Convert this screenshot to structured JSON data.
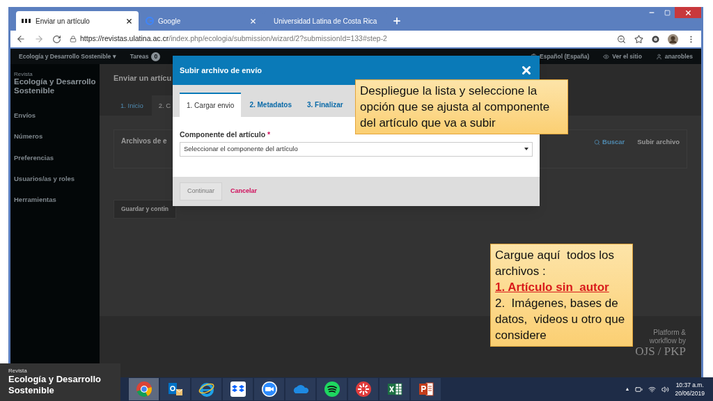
{
  "browser": {
    "tabs": [
      {
        "kind": "pkp",
        "title": "Enviar un artículo",
        "selected": true
      },
      {
        "kind": "google",
        "title": "Google",
        "selected": false
      },
      {
        "kind": "globe",
        "title": "Universidad Latina de Costa Rica",
        "selected": false
      }
    ],
    "url_host": "https://revistas.ulatina.ac.cr",
    "url_path": "/index.php/ecologia/submission/wizard/2?submissionId=133#step-2"
  },
  "site_nav": {
    "journal": "Ecología y Desarrollo Sostenible",
    "journal_caret": "▾",
    "tasks": "Tareas",
    "task_count": "0",
    "language": "Español (España)",
    "view_site": "Ver el sitio",
    "user": "anarobles"
  },
  "sidebar": {
    "kicker": "Revista",
    "journal": "Ecología y Desarrollo Sostenible",
    "items": [
      "Envíos",
      "Números",
      "Preferencias",
      "Usuarios/as y roles",
      "Herramientas"
    ]
  },
  "page": {
    "title": "Enviar un artícu",
    "tabs": [
      {
        "label": "1. Inicio",
        "selected": false
      },
      {
        "label": "2. C",
        "selected": true
      }
    ],
    "panel_title": "Archivos de e",
    "search": "Buscar",
    "upload": "Subir archivo",
    "save_button": "Guardar y contin",
    "footer": [
      "Platform &",
      "workflow by",
      "OJS / PKP"
    ]
  },
  "modal": {
    "title": "Subir archivo de envío",
    "tabs": [
      {
        "label": "1. Cargar envio",
        "selected": true
      },
      {
        "label": "2. Metadatos",
        "selected": false
      },
      {
        "label": "3. Finalizar",
        "selected": false
      }
    ],
    "field_label": "Componente del artículo",
    "required": "*",
    "select_value": "Seleccionar el componente del artículo",
    "continue": {
      "label": "Continuar",
      "disabled": true
    },
    "cancel": "Cancelar"
  },
  "callouts": [
    {
      "paragraphs": [
        {
          "kind": "text",
          "text": "Despliegue la lista y seleccione la opción que se ajusta al componente del artículo que va a subir"
        }
      ]
    },
    {
      "paragraphs": [
        {
          "kind": "text",
          "text": "Cargue aquí  todos los archivos :"
        },
        {
          "kind": "highlight",
          "text": "1. Artículo sin  autor"
        },
        {
          "kind": "text",
          "text": "2.  Imágenes, bases de datos,  videos u otro que considere"
        }
      ]
    }
  ],
  "overlay_label": {
    "kicker": "Revista",
    "title": "Ecología y Desarrollo Sostenible"
  },
  "taskbar": {
    "apps": [
      {
        "kind": "chrome",
        "selected": true
      },
      {
        "kind": "mail",
        "selected": false
      },
      {
        "kind": "ie",
        "selected": false
      },
      {
        "kind": "box",
        "selected": false
      },
      {
        "kind": "video",
        "selected": false
      },
      {
        "kind": "cloud",
        "selected": false
      },
      {
        "kind": "music",
        "selected": false
      },
      {
        "kind": "burst",
        "selected": false
      },
      {
        "kind": "sheet",
        "selected": false
      },
      {
        "kind": "slides",
        "selected": false
      }
    ],
    "tray_arrow": "▲",
    "time": "10:37 a.m.",
    "date": "20/06/2019"
  }
}
